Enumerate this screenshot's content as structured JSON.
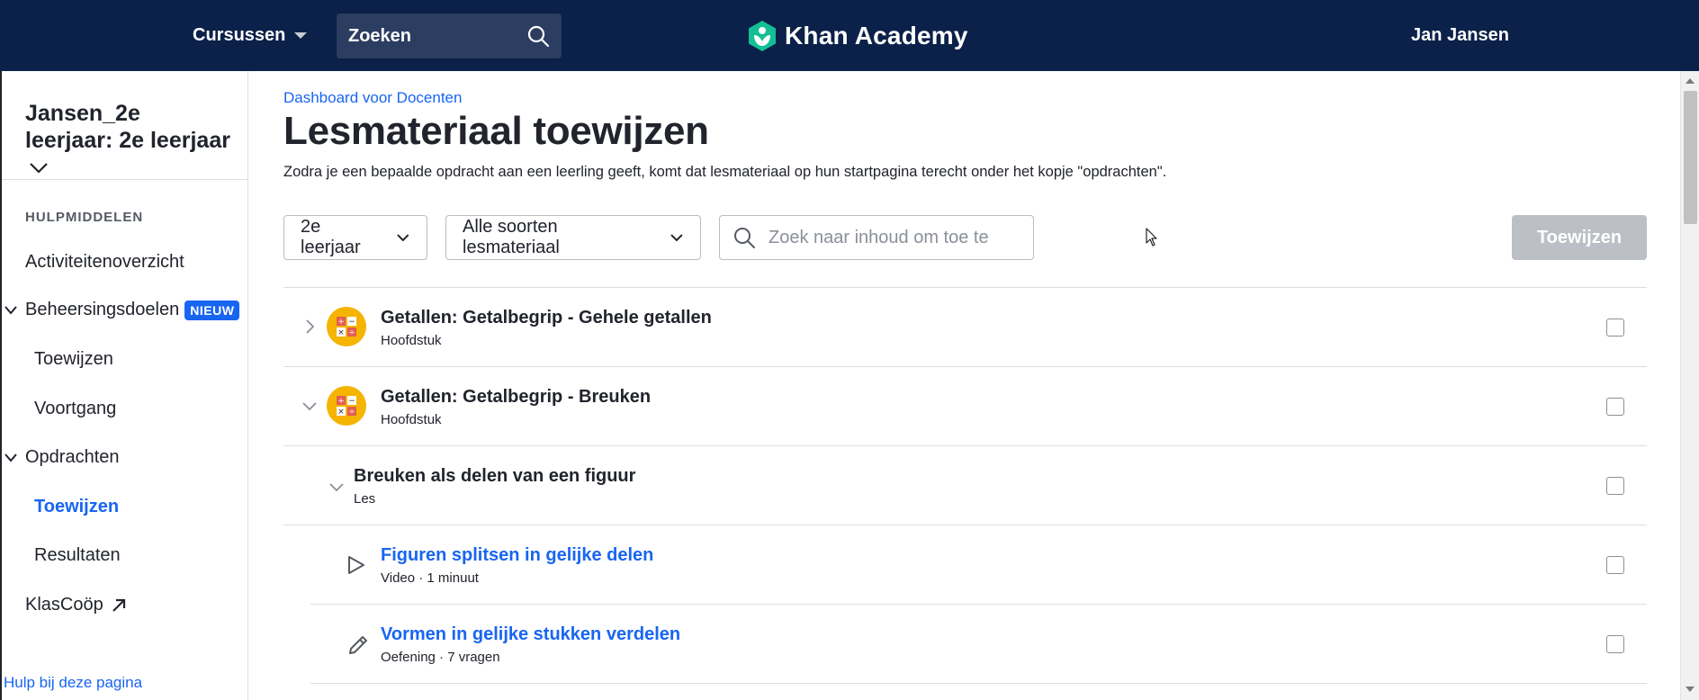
{
  "header": {
    "courses_label": "Cursussen",
    "search_label": "Zoeken",
    "brand": "Khan Academy",
    "user_name": "Jan Jansen",
    "background_color": "#0b2149"
  },
  "sidebar": {
    "class_name": "Jansen_2e leerjaar: 2e leerjaar",
    "section_heading": "HULPMIDDELEN",
    "items": [
      {
        "label": "Activiteitenoverzicht"
      },
      {
        "label": "Beheersingsdoelen",
        "badge": "NIEUW",
        "expanded": true
      },
      {
        "label": "Toewijzen"
      },
      {
        "label": "Voortgang"
      },
      {
        "label": "Opdrachten",
        "expanded": true
      },
      {
        "label": "Toewijzen",
        "active": true
      },
      {
        "label": "Resultaten"
      },
      {
        "label": "KlasCoöp"
      }
    ],
    "help_link": "Hulp bij deze pagina"
  },
  "main": {
    "breadcrumb": "Dashboard voor Docenten",
    "title": "Lesmateriaal toewijzen",
    "subtitle": "Zodra je een bepaalde opdracht aan een leerling geeft, komt dat lesmateriaal op hun startpagina terecht onder het kopje \"opdrachten\".",
    "filters": {
      "grade": "2e leerjaar",
      "content_type": "Alle soorten lesmateriaal",
      "search_placeholder": "Zoek naar inhoud om toe te v"
    },
    "assign_button": "Toewijzen",
    "content_rows": [
      {
        "title": "Getallen: Getalbegrip - Gehele getallen",
        "meta": "Hoofdstuk",
        "expanded": false,
        "checked": false
      },
      {
        "title": "Getallen: Getalbegrip - Breuken",
        "meta": "Hoofdstuk",
        "expanded": true,
        "checked": false
      },
      {
        "title": "Breuken als delen van een figuur",
        "meta": "Les",
        "expanded": true,
        "checked": false
      },
      {
        "title": "Figuren splitsen in gelijke delen",
        "meta": "Video · 1 minuut",
        "icon": "play-icon",
        "checked": false
      },
      {
        "title": "Vormen in gelijke stukken verdelen",
        "meta": "Oefening · 7 vragen",
        "icon": "pencil-icon",
        "checked": false
      }
    ]
  },
  "colors": {
    "accent": "#1865f2",
    "unit_icon": "#f5b400",
    "disabled_button": "#bcbfc5"
  }
}
